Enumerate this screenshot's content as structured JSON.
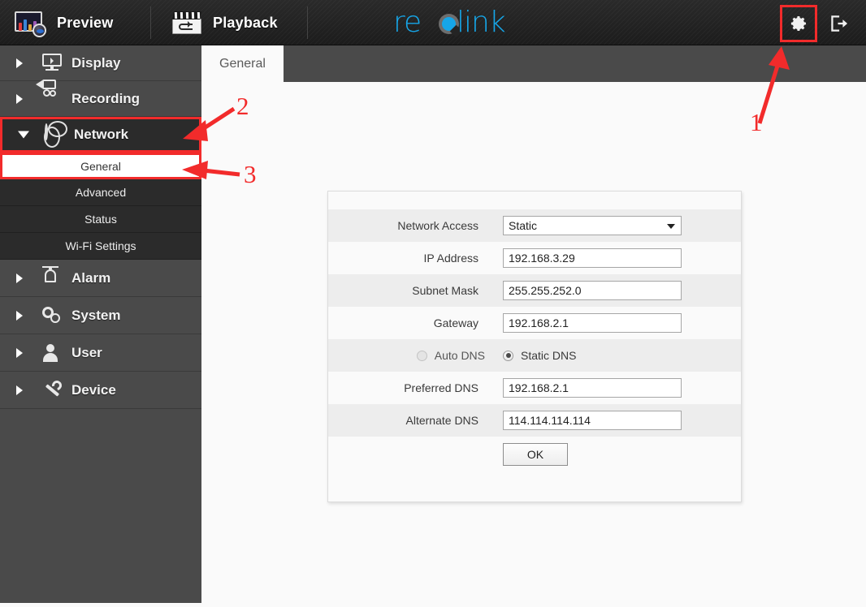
{
  "topbar": {
    "preview_label": "Preview",
    "playback_label": "Playback",
    "logo_part1": "re",
    "logo_part2": "link",
    "settings_icon": "gear-icon",
    "logout_icon": "logout-icon"
  },
  "sidebar": {
    "items": [
      {
        "label": "Display",
        "icon": "display-icon",
        "expanded": false
      },
      {
        "label": "Recording",
        "icon": "recording-icon",
        "expanded": false
      },
      {
        "label": "Network",
        "icon": "network-globe-icon",
        "expanded": true
      },
      {
        "label": "Alarm",
        "icon": "alarm-bell-icon",
        "expanded": false
      },
      {
        "label": "System",
        "icon": "gears-icon",
        "expanded": false
      },
      {
        "label": "User",
        "icon": "user-icon",
        "expanded": false
      },
      {
        "label": "Device",
        "icon": "wrench-icon",
        "expanded": false
      }
    ],
    "network_subitems": [
      {
        "label": "General",
        "selected": true
      },
      {
        "label": "Advanced",
        "selected": false
      },
      {
        "label": "Status",
        "selected": false
      },
      {
        "label": "Wi-Fi Settings",
        "selected": false
      }
    ]
  },
  "content": {
    "tabs": [
      {
        "label": "General",
        "active": true
      }
    ]
  },
  "form": {
    "rows": [
      {
        "label": "Network Access",
        "type": "select",
        "value": "Static"
      },
      {
        "label": "IP Address",
        "type": "text",
        "value": "192.168.3.29"
      },
      {
        "label": "Subnet Mask",
        "type": "text",
        "value": "255.255.252.0"
      },
      {
        "label": "Gateway",
        "type": "text",
        "value": "192.168.2.1"
      },
      {
        "label": "Preferred DNS",
        "type": "text",
        "value": "192.168.2.1"
      },
      {
        "label": "Alternate DNS",
        "type": "text",
        "value": "114.114.114.114"
      }
    ],
    "dns_mode": {
      "auto_label": "Auto DNS",
      "auto_selected": false,
      "static_label": "Static DNS",
      "static_selected": true
    },
    "ok_label": "OK"
  },
  "annotations": {
    "color": "#f22b2b",
    "steps": [
      {
        "number": "1",
        "target": "settings-gear-button"
      },
      {
        "number": "2",
        "target": "sidebar-item-network"
      },
      {
        "number": "3",
        "target": "sidebar-subitem-general"
      }
    ]
  }
}
